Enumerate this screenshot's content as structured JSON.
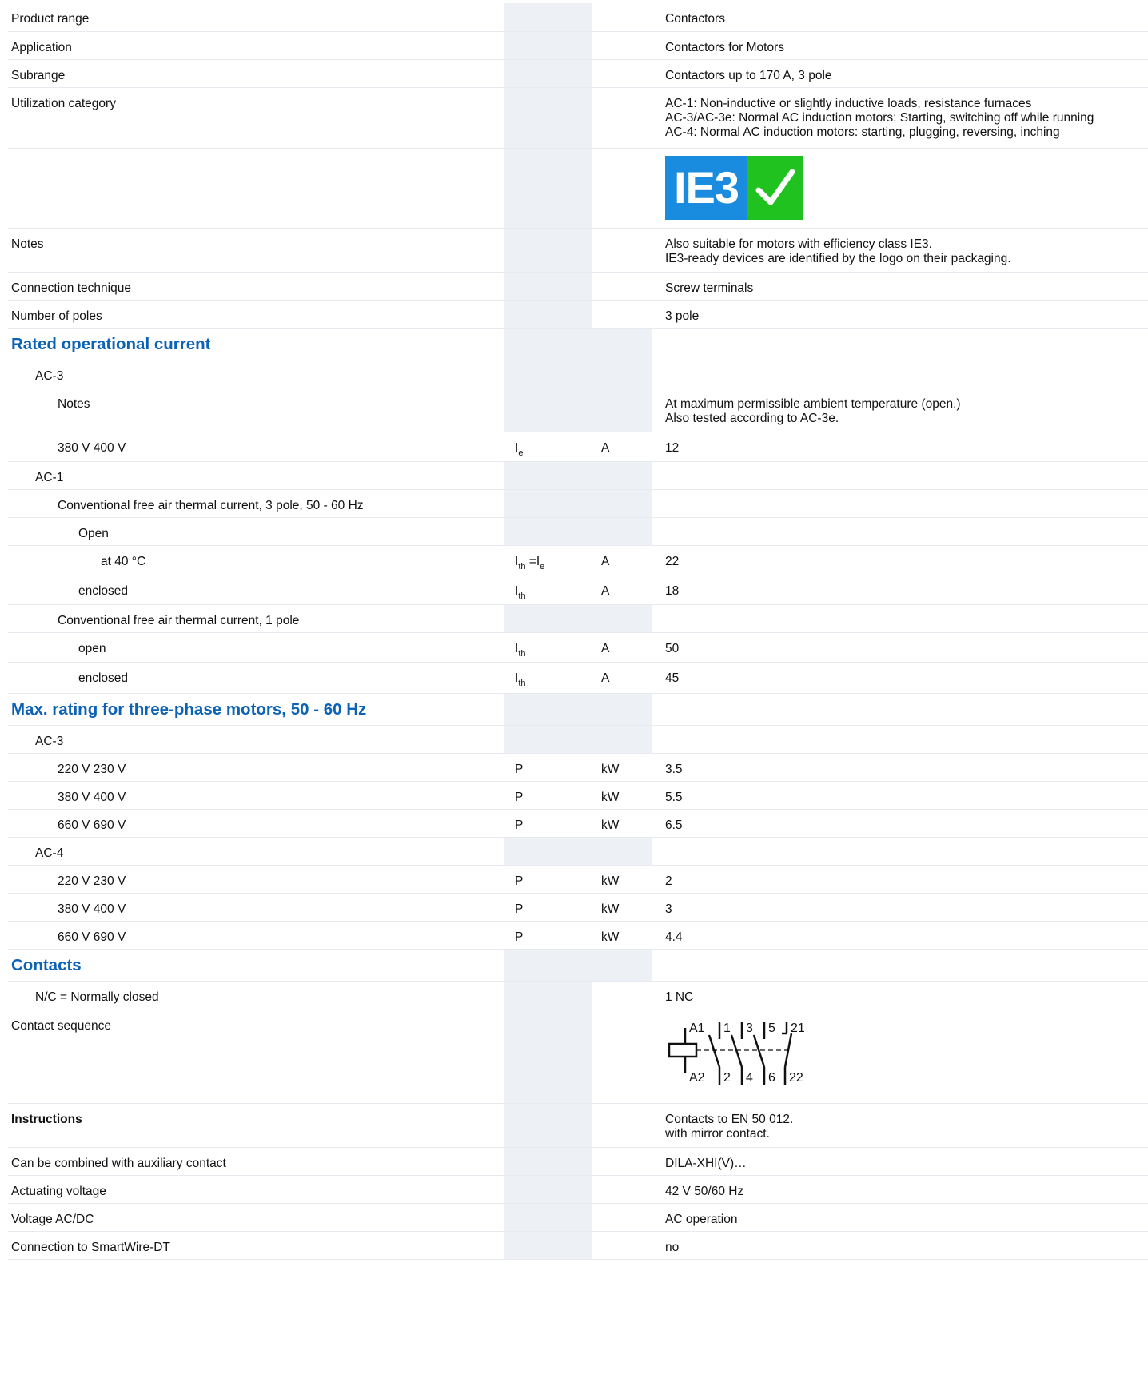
{
  "rows": {
    "product_range": {
      "label": "Product range",
      "value": "Contactors"
    },
    "application": {
      "label": "Application",
      "value": "Contactors for Motors"
    },
    "subrange": {
      "label": "Subrange",
      "value": "Contactors up to 170 A, 3 pole"
    },
    "utilization": {
      "label": "Utilization category",
      "value": "AC-1: Non-inductive or slightly inductive loads, resistance furnaces\nAC-3/AC-3e: Normal AC induction motors: Starting, switching off while running\nAC-4: Normal AC induction motors: starting, plugging, reversing, inching"
    },
    "ie3_logo": {
      "text": "IE3",
      "icon": "check-icon",
      "colors": {
        "blue": "#1a8ce0",
        "green": "#1fc21f"
      }
    },
    "notes": {
      "label": "Notes",
      "value": "Also suitable for motors with efficiency class IE3.\nIE3-ready devices are identified by the logo on their packaging."
    },
    "connection": {
      "label": "Connection technique",
      "value": "Screw terminals"
    },
    "poles": {
      "label": "Number of poles",
      "value": "3 pole"
    },
    "h_rated": {
      "label": "Rated operational current"
    },
    "ac3": {
      "label": "AC-3"
    },
    "ac3_notes": {
      "label": "Notes",
      "value": "At maximum permissible ambient temperature (open.)\nAlso tested according to AC-3e."
    },
    "ac3_380": {
      "label": "380 V 400 V",
      "sym": "I",
      "sub": "e",
      "unit": "A",
      "value": "12"
    },
    "ac1": {
      "label": "AC-1"
    },
    "conv3": {
      "label": "Conventional free air thermal current, 3 pole, 50 - 60 Hz"
    },
    "open": {
      "label": "Open"
    },
    "at40": {
      "label": "at 40 °C",
      "sym": "I",
      "sub": "th",
      "mid": " =I",
      "sub2": "e",
      "unit": "A",
      "value": "22"
    },
    "encl1": {
      "label": "enclosed",
      "sym": "I",
      "sub": "th",
      "unit": "A",
      "value": "18"
    },
    "conv1": {
      "label": "Conventional free air thermal current, 1 pole"
    },
    "open1": {
      "label": "open",
      "sym": "I",
      "sub": "th",
      "unit": "A",
      "value": "50"
    },
    "encl2": {
      "label": "enclosed",
      "sym": "I",
      "sub": "th",
      "unit": "A",
      "value": "45"
    },
    "h_max": {
      "label": "Max. rating for three-phase motors, 50 - 60 Hz"
    },
    "m_ac3": {
      "label": "AC-3"
    },
    "m3_220": {
      "label": "220 V 230 V",
      "sym": "P",
      "unit": "kW",
      "value": "3.5"
    },
    "m3_380": {
      "label": "380 V 400 V",
      "sym": "P",
      "unit": "kW",
      "value": "5.5"
    },
    "m3_660": {
      "label": "660 V 690 V",
      "sym": "P",
      "unit": "kW",
      "value": "6.5"
    },
    "m_ac4": {
      "label": "AC-4"
    },
    "m4_220": {
      "label": "220 V 230 V",
      "sym": "P",
      "unit": "kW",
      "value": "2"
    },
    "m4_380": {
      "label": "380 V 400 V",
      "sym": "P",
      "unit": "kW",
      "value": "3"
    },
    "m4_660": {
      "label": "660 V 690 V",
      "sym": "P",
      "unit": "kW",
      "value": "4.4"
    },
    "h_contacts": {
      "label": "Contacts"
    },
    "nc": {
      "label": "N/C = Normally closed",
      "value": "1 NC"
    },
    "sequence": {
      "label": "Contact sequence",
      "diagram_labels": {
        "a1": "A1",
        "a2": "A2",
        "t1": "1",
        "t2": "2",
        "t3": "3",
        "t4": "4",
        "t5": "5",
        "t6": "6",
        "t21": "21",
        "t22": "22"
      }
    },
    "instructions": {
      "label": "Instructions",
      "value": "Contacts to EN 50 012.\nwith mirror contact."
    },
    "aux": {
      "label": "Can be combined with auxiliary contact",
      "value": "DILA-XHI(V)…"
    },
    "actuating": {
      "label": "Actuating voltage",
      "value": "42 V 50/60 Hz"
    },
    "voltage": {
      "label": "Voltage AC/DC",
      "value": "AC operation"
    },
    "smartwire": {
      "label": "Connection to SmartWire-DT",
      "value": "no"
    }
  }
}
